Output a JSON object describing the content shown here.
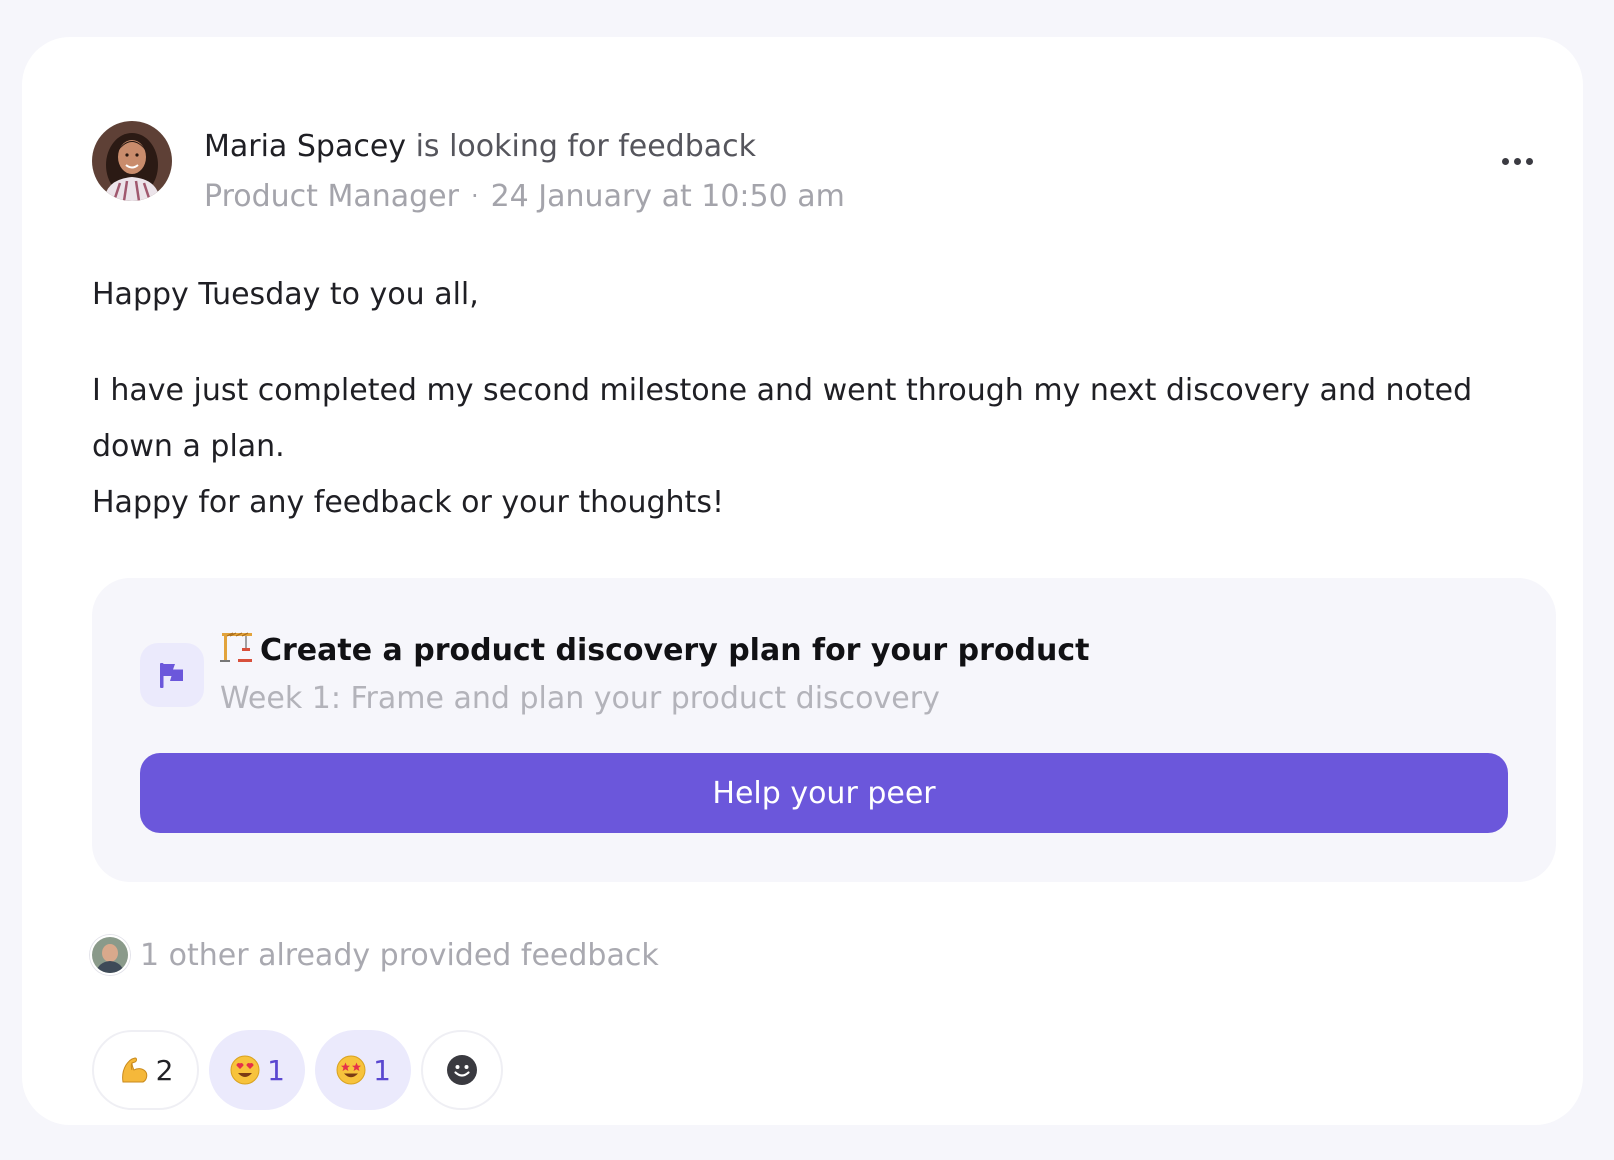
{
  "post": {
    "author_name": "Maria Spacey",
    "action_text": "is looking for feedback",
    "author_role": "Product Manager",
    "meta_separator": "·",
    "timestamp": "24 January at 10:50 am",
    "body": {
      "greeting": "Happy Tuesday to you all,",
      "paragraph_1": "I have just completed my second milestone and went through my next discovery and noted down a plan.",
      "paragraph_2": "Happy for any feedback or your thoughts!"
    }
  },
  "task": {
    "emoji_icon": "construction-crane-icon",
    "title": "Create a product discovery plan for your product",
    "subtitle": "Week 1: Frame and plan your product discovery",
    "badge_icon": "flag-icon",
    "cta_label": "Help your peer"
  },
  "feedback_summary": {
    "text": "1 other already provided feedback"
  },
  "reactions": [
    {
      "icon": "flexed-biceps-icon",
      "count": "2",
      "active": false
    },
    {
      "icon": "heart-eyes-icon",
      "count": "1",
      "active": true
    },
    {
      "icon": "star-struck-icon",
      "count": "1",
      "active": true
    }
  ],
  "add_reaction_icon": "add-reaction-smiley-icon",
  "colors": {
    "accent": "#6b57db",
    "accent_light": "#ebeafc",
    "page_bg": "#f6f6fb",
    "muted_text": "#a4a4ab"
  }
}
